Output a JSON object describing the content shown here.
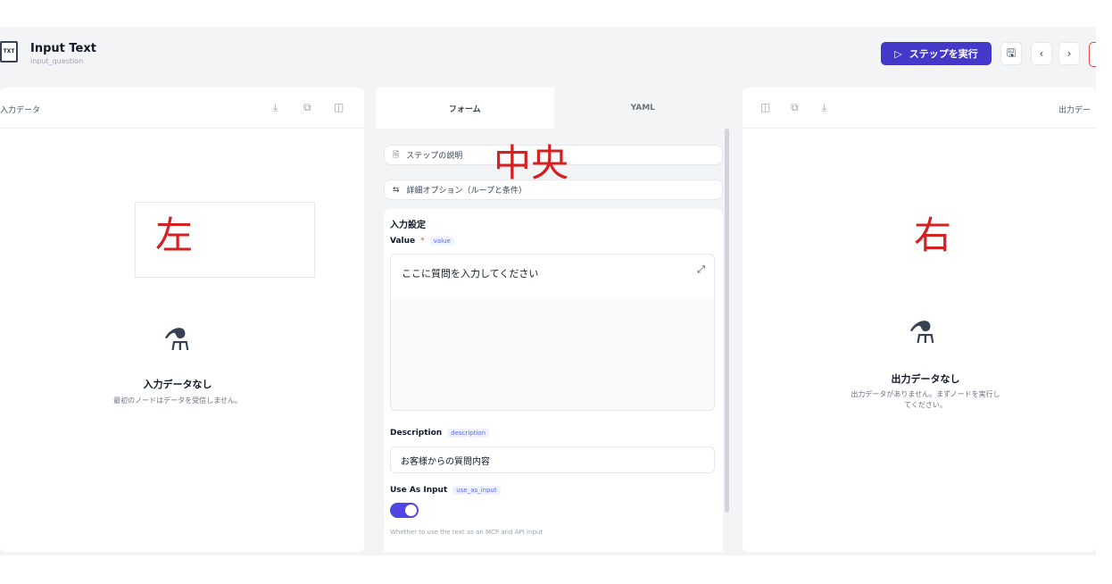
{
  "header": {
    "node_icon": "TXT",
    "title": "Input Text",
    "subtitle": "input_question",
    "run_button": {
      "icon": "play-icon",
      "glyph": "▷",
      "label": "ステップを実行"
    },
    "save_glyph": "🖫",
    "prev_glyph": "‹",
    "next_glyph": "›"
  },
  "left_panel": {
    "label": "入力データ",
    "annotation": "左",
    "empty_glyph": "⚗",
    "empty_title": "入力データなし",
    "empty_desc": "最初のノードはデータを受信しません。"
  },
  "center_panel": {
    "tabs": [
      {
        "label": "フォーム",
        "active": true
      },
      {
        "label": "YAML",
        "active": false
      }
    ],
    "annotation": "中央",
    "step_description": {
      "icon": "document-icon",
      "glyph": "🗎",
      "label": "ステップの説明"
    },
    "advanced_options": {
      "icon": "settings-icon",
      "glyph": "⇆",
      "label": "詳細オプション（ループと条件）"
    },
    "section_title": "入力設定",
    "value_field": {
      "label": "Value",
      "required_mark": "*",
      "key": "value",
      "text": "ここに質問を入力してください",
      "expand_glyph": "⤢"
    },
    "description_field": {
      "label": "Description",
      "key": "description",
      "text": "お客様からの質問内容"
    },
    "use_as_input_field": {
      "label": "Use As Input",
      "key": "use_as_input",
      "enabled": true,
      "help": "Whether to use the text as an MCP and API input"
    }
  },
  "right_panel": {
    "label": "出力デー",
    "annotation": "右",
    "empty_glyph": "⚗",
    "empty_title": "出力データなし",
    "empty_desc_line1": "出力データがありません。まずノードを実行し",
    "empty_desc_line2": "てください。"
  },
  "colors": {
    "accent": "#4338ca",
    "annotation": "#d62020",
    "toggle": "#4f46e5"
  }
}
